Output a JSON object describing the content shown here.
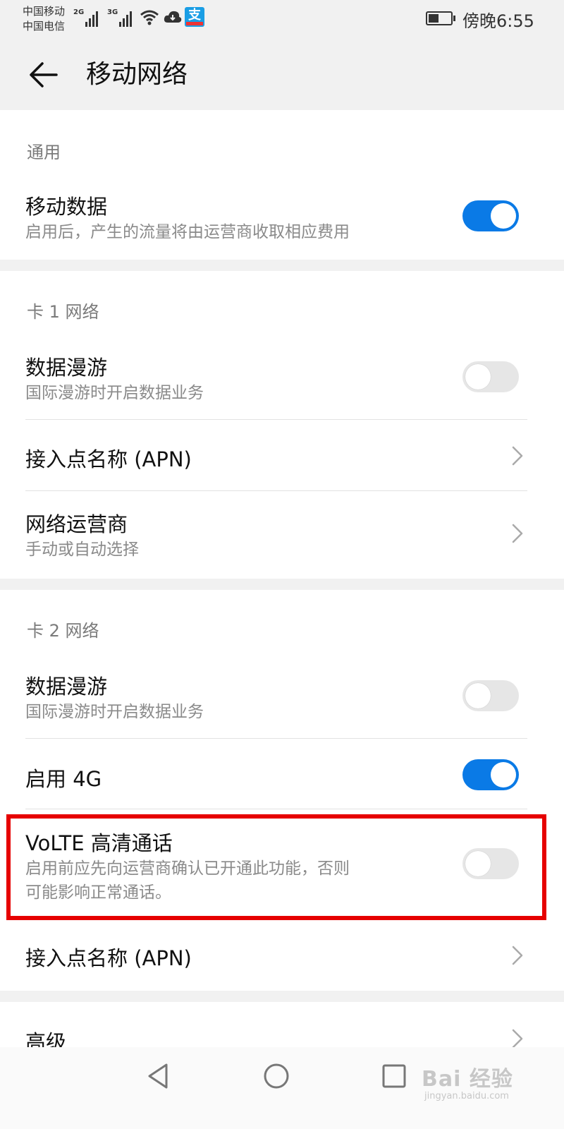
{
  "status_bar": {
    "carrier_1": "中国移动",
    "carrier_2": "中国电信",
    "sim1_network": "2G",
    "sim2_network": "3G",
    "time": "傍晚6:55",
    "icons": [
      "signal-icon",
      "signal-icon",
      "wifi-icon",
      "cloud-icon",
      "alipay-icon",
      "battery-icon"
    ]
  },
  "header": {
    "title": "移动网络",
    "back_icon": "arrow-left-icon"
  },
  "general": {
    "section_title": "通用",
    "mobile_data": {
      "title": "移动数据",
      "subtitle": "启用后，产生的流量将由运营商收取相应费用",
      "enabled": true
    }
  },
  "sim1": {
    "section_title": "卡 1 网络",
    "roaming": {
      "title": "数据漫游",
      "subtitle": "国际漫游时开启数据业务",
      "enabled": false
    },
    "apn": {
      "title": "接入点名称 (APN)"
    },
    "operator": {
      "title": "网络运营商",
      "subtitle": "手动或自动选择"
    }
  },
  "sim2": {
    "section_title": "卡 2 网络",
    "roaming": {
      "title": "数据漫游",
      "subtitle": "国际漫游时开启数据业务",
      "enabled": false
    },
    "enable_4g": {
      "title": "启用 4G",
      "enabled": true
    },
    "volte": {
      "title": "VoLTE 高清通话",
      "subtitle_line1": "启用前应先向运营商确认已开通此功能，否则",
      "subtitle_line2": "可能影响正常通话。",
      "enabled": false
    },
    "apn": {
      "title": "接入点名称 (APN)"
    }
  },
  "advanced": {
    "title": "高级"
  },
  "nav_bar": {
    "icons": [
      "back-triangle-icon",
      "home-circle-icon",
      "recents-square-icon"
    ]
  },
  "watermark": {
    "main": "Bai 经验",
    "sub": "jingyan.baidu.com"
  },
  "colors": {
    "accent": "#0a7ae6",
    "highlight": "#e60000",
    "background": "#f1f1f1"
  }
}
